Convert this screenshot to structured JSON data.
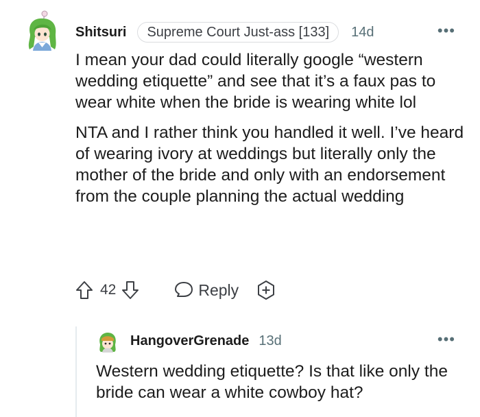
{
  "comment": {
    "username": "Shitsuri",
    "flair": "Supreme Court Just-ass [133]",
    "timestamp": "14d",
    "more_label": "•••",
    "paragraphs": [
      "I mean your dad could literally google “western wedding etiquette” and see that it’s a faux pas to wear white when the bride is wearing white lol",
      "NTA and I rather think you handled it well. I’ve heard of wearing ivory at weddings but literally only the mother of the bride and only with an endorsement from the couple planning the actual wedding"
    ],
    "score": "42",
    "reply_label": "Reply",
    "icons": {
      "avatar": "avatar-green-hair",
      "upvote": "arrow-up-outline",
      "downvote": "arrow-down-outline",
      "reply": "speech-bubble-outline",
      "award": "award-plus-outline"
    }
  },
  "reply": {
    "username": "HangoverGrenade",
    "timestamp": "13d",
    "more_label": "•••",
    "body": "Western wedding etiquette? Is that like only the bride can wear a white cowboy hat?",
    "icons": {
      "avatar": "avatar-green-bandana"
    }
  },
  "colors": {
    "text": "#1c1c1c",
    "meta": "#576f76",
    "action": "#3c3f44",
    "flair_border": "#dadcdf",
    "thread_line": "#e5ebee",
    "avatar_hair": "#5fb544"
  }
}
